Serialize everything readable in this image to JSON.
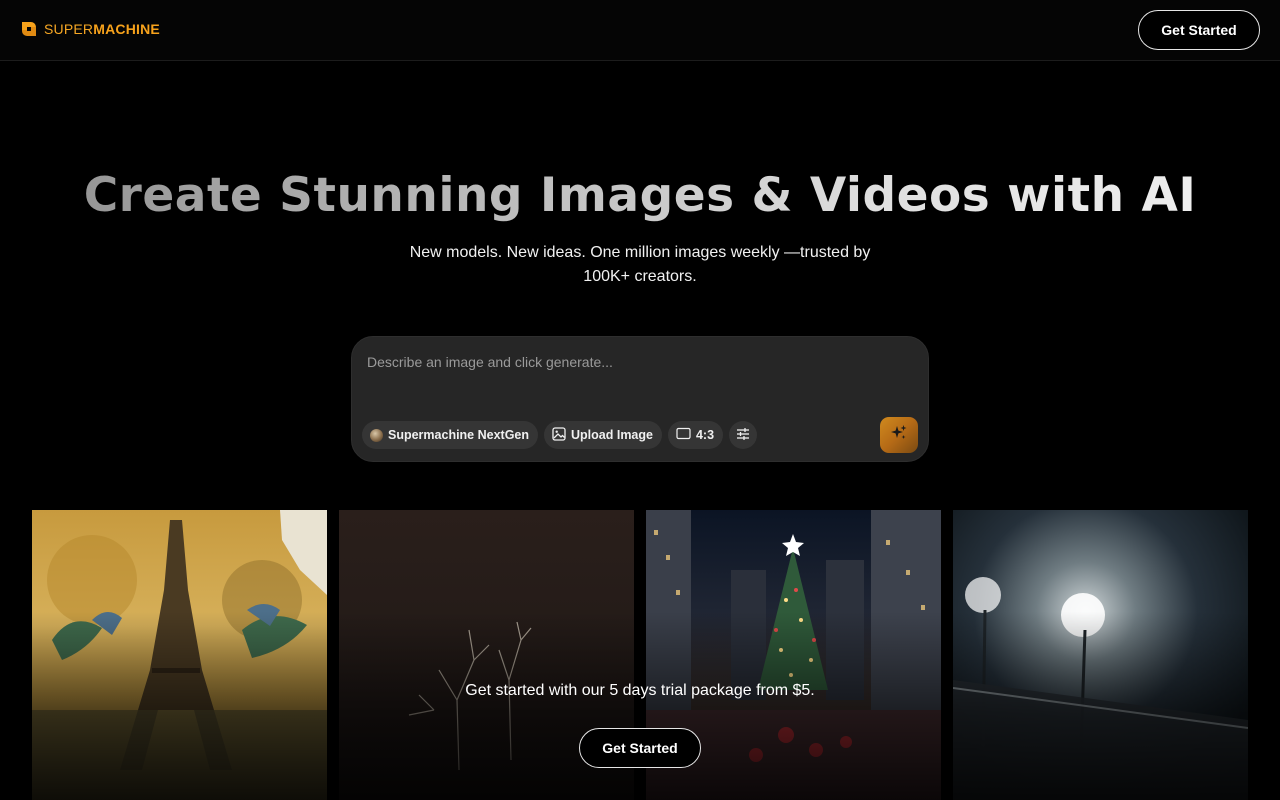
{
  "header": {
    "logo": {
      "part1": "SUPER",
      "part2": "MACHINE",
      "icon": "supermachine-logo-icon"
    },
    "cta_label": "Get Started"
  },
  "hero": {
    "title": "Create Stunning Images & Videos with AI",
    "subtitle": "New models. New ideas. One million images weekly —trusted by 100K+ creators."
  },
  "prompt": {
    "placeholder": "Describe an image and click generate...",
    "value": "",
    "model_label": "Supermachine NextGen",
    "upload_label": "Upload Image",
    "aspect_label": "4:3",
    "settings_icon": "sliders-icon",
    "generate_icon": "sparkle-icon"
  },
  "gallery": {
    "tiles": [
      {
        "subject": "eiffel-tower-painting"
      },
      {
        "subject": "bare-tree-dark"
      },
      {
        "subject": "christmas-tree-city"
      },
      {
        "subject": "stadium-lights-fog"
      }
    ]
  },
  "cta": {
    "text": "Get started with our 5 days trial package from $5.",
    "button_label": "Get Started"
  },
  "colors": {
    "background": "#000000",
    "accent": "#f7a21b",
    "prompt_bg": "#262626",
    "chip_bg": "#353535"
  }
}
